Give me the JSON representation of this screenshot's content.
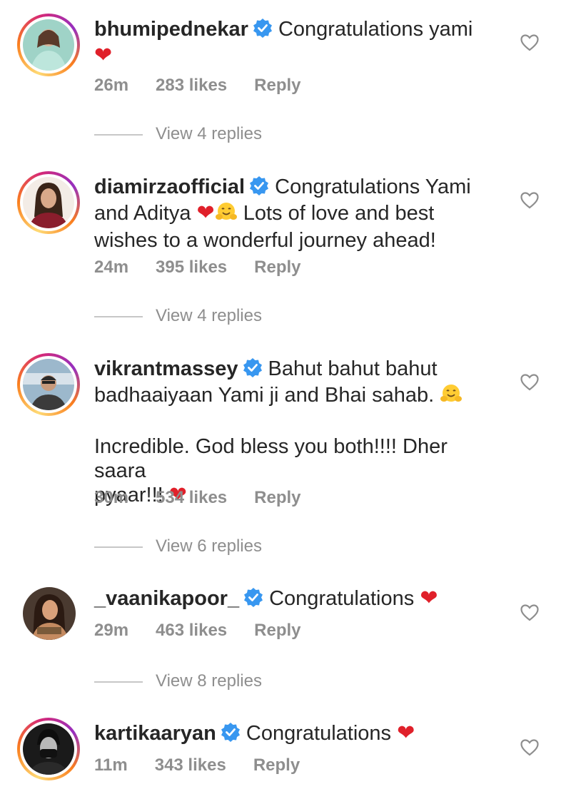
{
  "comments": [
    {
      "username": "bhumipednekar",
      "text_1": "Congratulations yami",
      "time": "26m",
      "likes": "283 likes",
      "reply": "Reply",
      "view_replies": "View 4 replies"
    },
    {
      "username": "diamirzaofficial",
      "text_1": "Congratulations Yami",
      "text_2": "and Aditya",
      "text_3": "Lots of love and best",
      "text_4": "wishes to a wonderful journey ahead!",
      "time": "24m",
      "likes": "395 likes",
      "reply": "Reply",
      "view_replies": "View 4 replies"
    },
    {
      "username": "vikrantmassey",
      "text_1": "Bahut bahut bahut",
      "text_2": "badhaaiyaan Yami ji and Bhai sahab.",
      "text_3": "Incredible. God bless you both!!!! Dher saara",
      "text_4": "pyaar!!!",
      "time": "30m",
      "likes": "534 likes",
      "reply": "Reply",
      "view_replies": "View 6 replies"
    },
    {
      "username": "_vaanikapoor_",
      "text_1": "Congratulations",
      "time": "29m",
      "likes": "463 likes",
      "reply": "Reply",
      "view_replies": "View 8 replies"
    },
    {
      "username": "kartikaaryan",
      "text_1": "Congratulations",
      "time": "11m",
      "likes": "343 likes",
      "reply": "Reply"
    }
  ],
  "icons": {
    "verified": "verified-badge-icon",
    "heart_emoji": "red-heart-emoji",
    "hug_emoji": "hugging-face-emoji",
    "like": "heart-outline-icon"
  },
  "colors": {
    "verified_blue": "#3897f0",
    "heart_red": "#e0202a",
    "meta_gray": "#8e8e8e",
    "text": "#262626"
  }
}
